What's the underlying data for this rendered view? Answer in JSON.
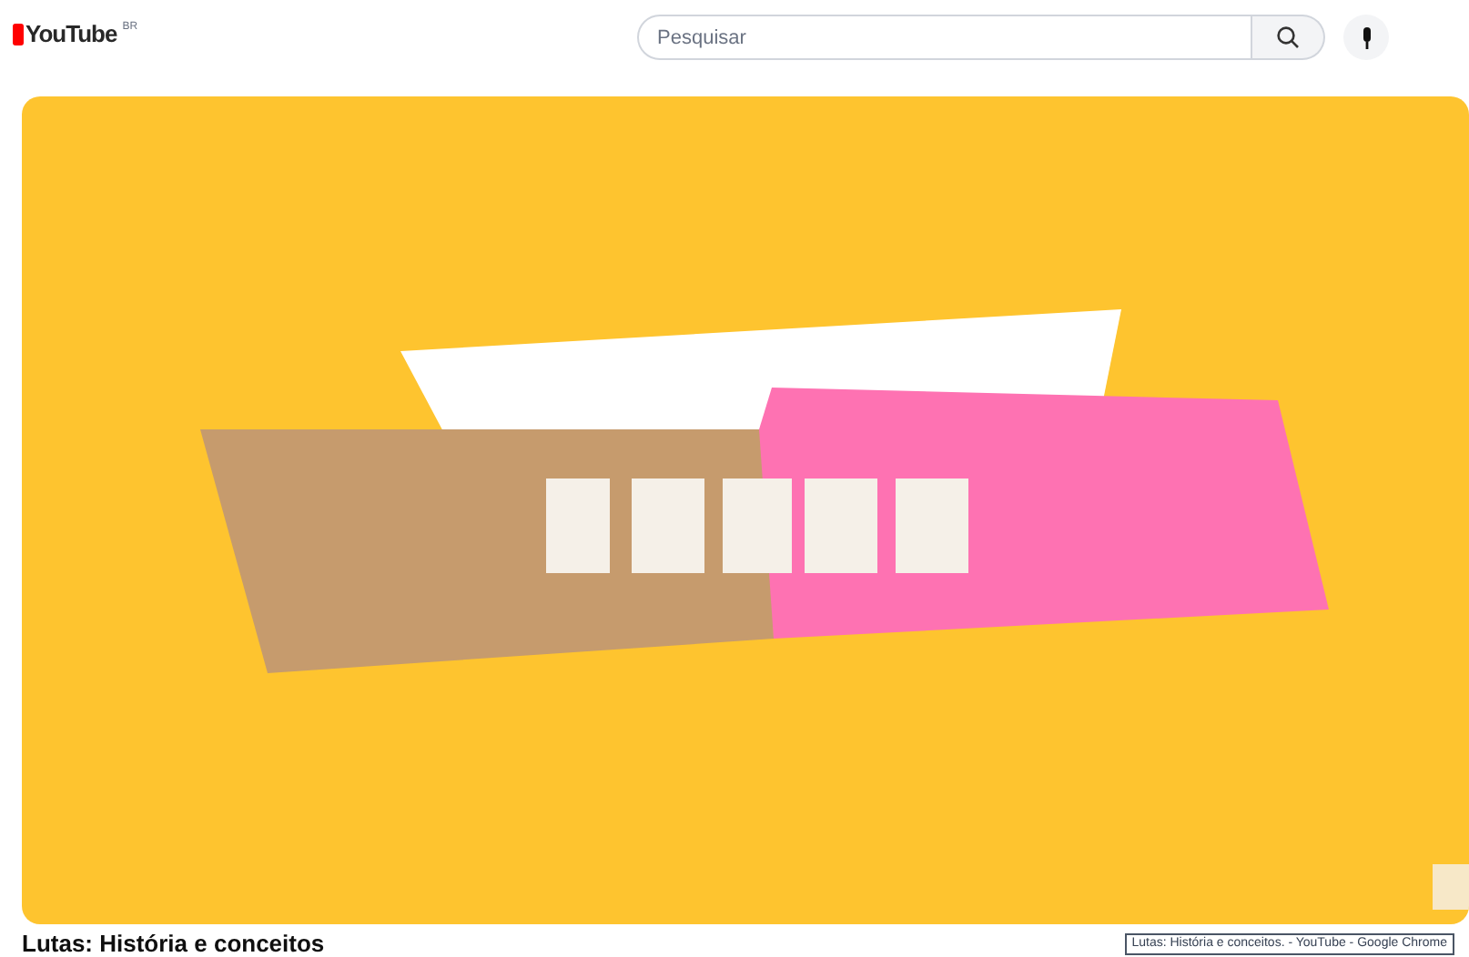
{
  "header": {
    "logo": "YouTube",
    "region": "BR",
    "search": {
      "placeholder": "Pesquisar"
    }
  },
  "video_title": "Lutas: História e conceitos",
  "tooltip": "Lutas: História e conceitos. - YouTube - Google Chrome"
}
